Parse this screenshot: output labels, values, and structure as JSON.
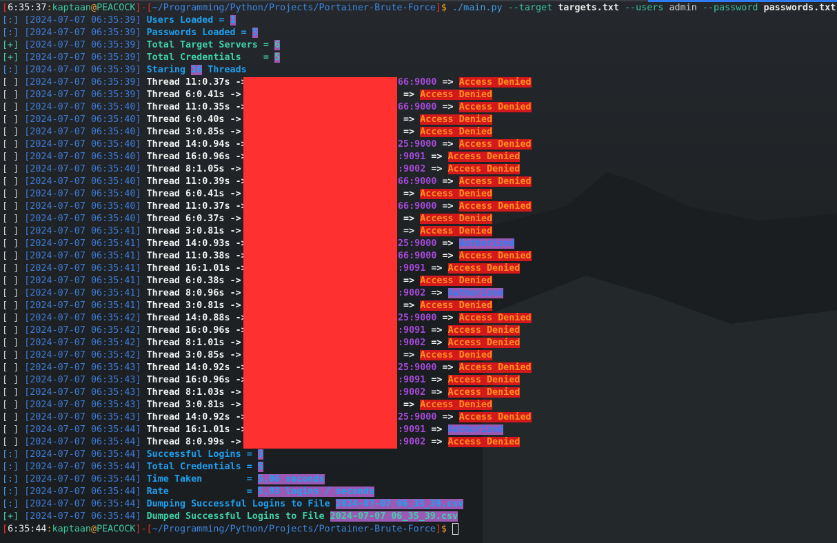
{
  "prompt_start": {
    "time": "6:35:37",
    "user": "kaptaan",
    "host": "PEACOCK",
    "path": "~/Programming/Python/Projects/Portainer-Brute-Force",
    "symbol": "$",
    "command": {
      "program": "./main.py",
      "flag_target": "--target",
      "target_file": "targets.txt",
      "flag_users": "--users",
      "users": "admin",
      "flag_password": "--password",
      "password_file": "passwords.txt"
    }
  },
  "header_lines": [
    {
      "marker": "[:]",
      "ts": "[2024-07-07 06:35:39]",
      "label": "Users Loaded = ",
      "value": "1",
      "style": "info"
    },
    {
      "marker": "[:]",
      "ts": "[2024-07-07 06:35:39]",
      "label": "Passwords Loaded = ",
      "value": "5",
      "style": "info"
    },
    {
      "marker": "[+]",
      "ts": "[2024-07-07 06:35:39]",
      "label": "Total Target Servers = ",
      "value": "6",
      "style": "ok"
    },
    {
      "marker": "[+]",
      "ts": "[2024-07-07 06:35:39]",
      "label": "Total Credentials    = ",
      "value": "5",
      "style": "ok"
    },
    {
      "marker": "[:]",
      "ts": "[2024-07-07 06:35:39]",
      "label": "Staring ",
      "value": "16",
      "after": " Threads",
      "style": "info"
    }
  ],
  "thread_rows": [
    {
      "ts": "06:35:39",
      "thread": "Thread 11:0.37s ->",
      "port": "66:9000",
      "status": "Access Denied"
    },
    {
      "ts": "06:35:39",
      "thread": "Thread 6:0.41s ->",
      "port": "",
      "status": "Access Denied"
    },
    {
      "ts": "06:35:40",
      "thread": "Thread 11:0.35s ->",
      "port": "66:9000",
      "status": "Access Denied"
    },
    {
      "ts": "06:35:40",
      "thread": "Thread 6:0.40s ->",
      "port": "",
      "status": "Access Denied"
    },
    {
      "ts": "06:35:40",
      "thread": "Thread 3:0.85s ->",
      "port": "",
      "status": "Access Denied"
    },
    {
      "ts": "06:35:40",
      "thread": "Thread 14:0.94s ->",
      "port": "25:9000",
      "status": "Access Denied"
    },
    {
      "ts": "06:35:40",
      "thread": "Thread 16:0.96s ->",
      "port": ":9091",
      "status": "Access Denied"
    },
    {
      "ts": "06:35:40",
      "thread": "Thread 8:1.05s ->",
      "port": ":9002",
      "status": "Access Denied"
    },
    {
      "ts": "06:35:40",
      "thread": "Thread 11:0.39s ->",
      "port": "66:9000",
      "status": "Access Denied"
    },
    {
      "ts": "06:35:40",
      "thread": "Thread 6:0.41s ->",
      "port": "",
      "status": "Access Denied"
    },
    {
      "ts": "06:35:40",
      "thread": "Thread 11:0.37s ->",
      "port": "66:9000",
      "status": "Access Denied"
    },
    {
      "ts": "06:35:40",
      "thread": "Thread 6:0.37s ->",
      "port": "",
      "status": "Access Denied"
    },
    {
      "ts": "06:35:41",
      "thread": "Thread 3:0.81s ->",
      "port": "",
      "status": "Access Denied"
    },
    {
      "ts": "06:35:41",
      "thread": "Thread 14:0.93s ->",
      "port": "25:9000",
      "status": "Authorized"
    },
    {
      "ts": "06:35:41",
      "thread": "Thread 11:0.38s ->",
      "port": "66:9000",
      "status": "Access Denied"
    },
    {
      "ts": "06:35:41",
      "thread": "Thread 16:1.01s ->",
      "port": ":9091",
      "status": "Access Denied"
    },
    {
      "ts": "06:35:41",
      "thread": "Thread 6:0.38s ->",
      "port": "",
      "status": "Access Denied"
    },
    {
      "ts": "06:35:41",
      "thread": "Thread 8:0.96s ->",
      "port": ":9002",
      "status": "Authorized"
    },
    {
      "ts": "06:35:41",
      "thread": "Thread 3:0.81s ->",
      "port": "",
      "status": "Access Denied"
    },
    {
      "ts": "06:35:42",
      "thread": "Thread 14:0.88s ->",
      "port": "25:9000",
      "status": "Access Denied"
    },
    {
      "ts": "06:35:42",
      "thread": "Thread 16:0.96s ->",
      "port": ":9091",
      "status": "Access Denied"
    },
    {
      "ts": "06:35:42",
      "thread": "Thread 8:1.01s ->",
      "port": ":9002",
      "status": "Access Denied"
    },
    {
      "ts": "06:35:42",
      "thread": "Thread 3:0.85s ->",
      "port": "",
      "status": "Access Denied"
    },
    {
      "ts": "06:35:43",
      "thread": "Thread 14:0.92s ->",
      "port": "25:9000",
      "status": "Access Denied"
    },
    {
      "ts": "06:35:43",
      "thread": "Thread 16:0.96s ->",
      "port": ":9091",
      "status": "Access Denied"
    },
    {
      "ts": "06:35:43",
      "thread": "Thread 8:1.03s ->",
      "port": ":9002",
      "status": "Access Denied"
    },
    {
      "ts": "06:35:43",
      "thread": "Thread 3:0.81s ->",
      "port": "",
      "status": "Access Denied"
    },
    {
      "ts": "06:35:43",
      "thread": "Thread 14:0.92s ->",
      "port": "25:9000",
      "status": "Access Denied"
    },
    {
      "ts": "06:35:44",
      "thread": "Thread 16:1.01s ->",
      "port": ":9091",
      "status": "Authorized"
    },
    {
      "ts": "06:35:44",
      "thread": "Thread 8:0.99s ->",
      "port": ":9002",
      "status": "Access Denied"
    }
  ],
  "thread_marker": "[ ]",
  "thread_date": "2024-07-07",
  "arrow": " => ",
  "footer_lines": [
    {
      "marker": "[:]",
      "ts": "[2024-07-07 06:35:44]",
      "label": "Successful Logins = ",
      "value": "3",
      "style": "info"
    },
    {
      "marker": "[:]",
      "ts": "[2024-07-07 06:35:44]",
      "label": "Total Credentials = ",
      "value": "5",
      "style": "info"
    },
    {
      "marker": "[:]",
      "ts": "[2024-07-07 06:35:44]",
      "label": "Time Taken        = ",
      "value": "5.06 seconds",
      "style": "info"
    },
    {
      "marker": "[:]",
      "ts": "[2024-07-07 06:35:44]",
      "label": "Rate              = ",
      "value": "5.93 logins / seconds",
      "style": "info"
    },
    {
      "marker": "[:]",
      "ts": "[2024-07-07 06:35:44]",
      "label": "Dumping Successful Logins to File ",
      "value": "2024-07-07 06_35_39.csv",
      "style": "info"
    },
    {
      "marker": "[+]",
      "ts": "[2024-07-07 06:35:44]",
      "label": "Dumped Successful Logins to File ",
      "value": "2024-07-07 06_35_39.csv",
      "style": "ok"
    }
  ],
  "prompt_end": {
    "time": "6:35:44",
    "user": "kaptaan",
    "host": "PEACOCK",
    "path": "~/Programming/Python/Projects/Portainer-Brute-Force",
    "symbol": "$"
  },
  "colors": {
    "denied_bg": "#d3191b",
    "denied_fg": "#ff8f1f",
    "authorized_bg": "#9b59b6",
    "authorized_fg": "#2f7ff0",
    "redaction": "#ff3030"
  }
}
